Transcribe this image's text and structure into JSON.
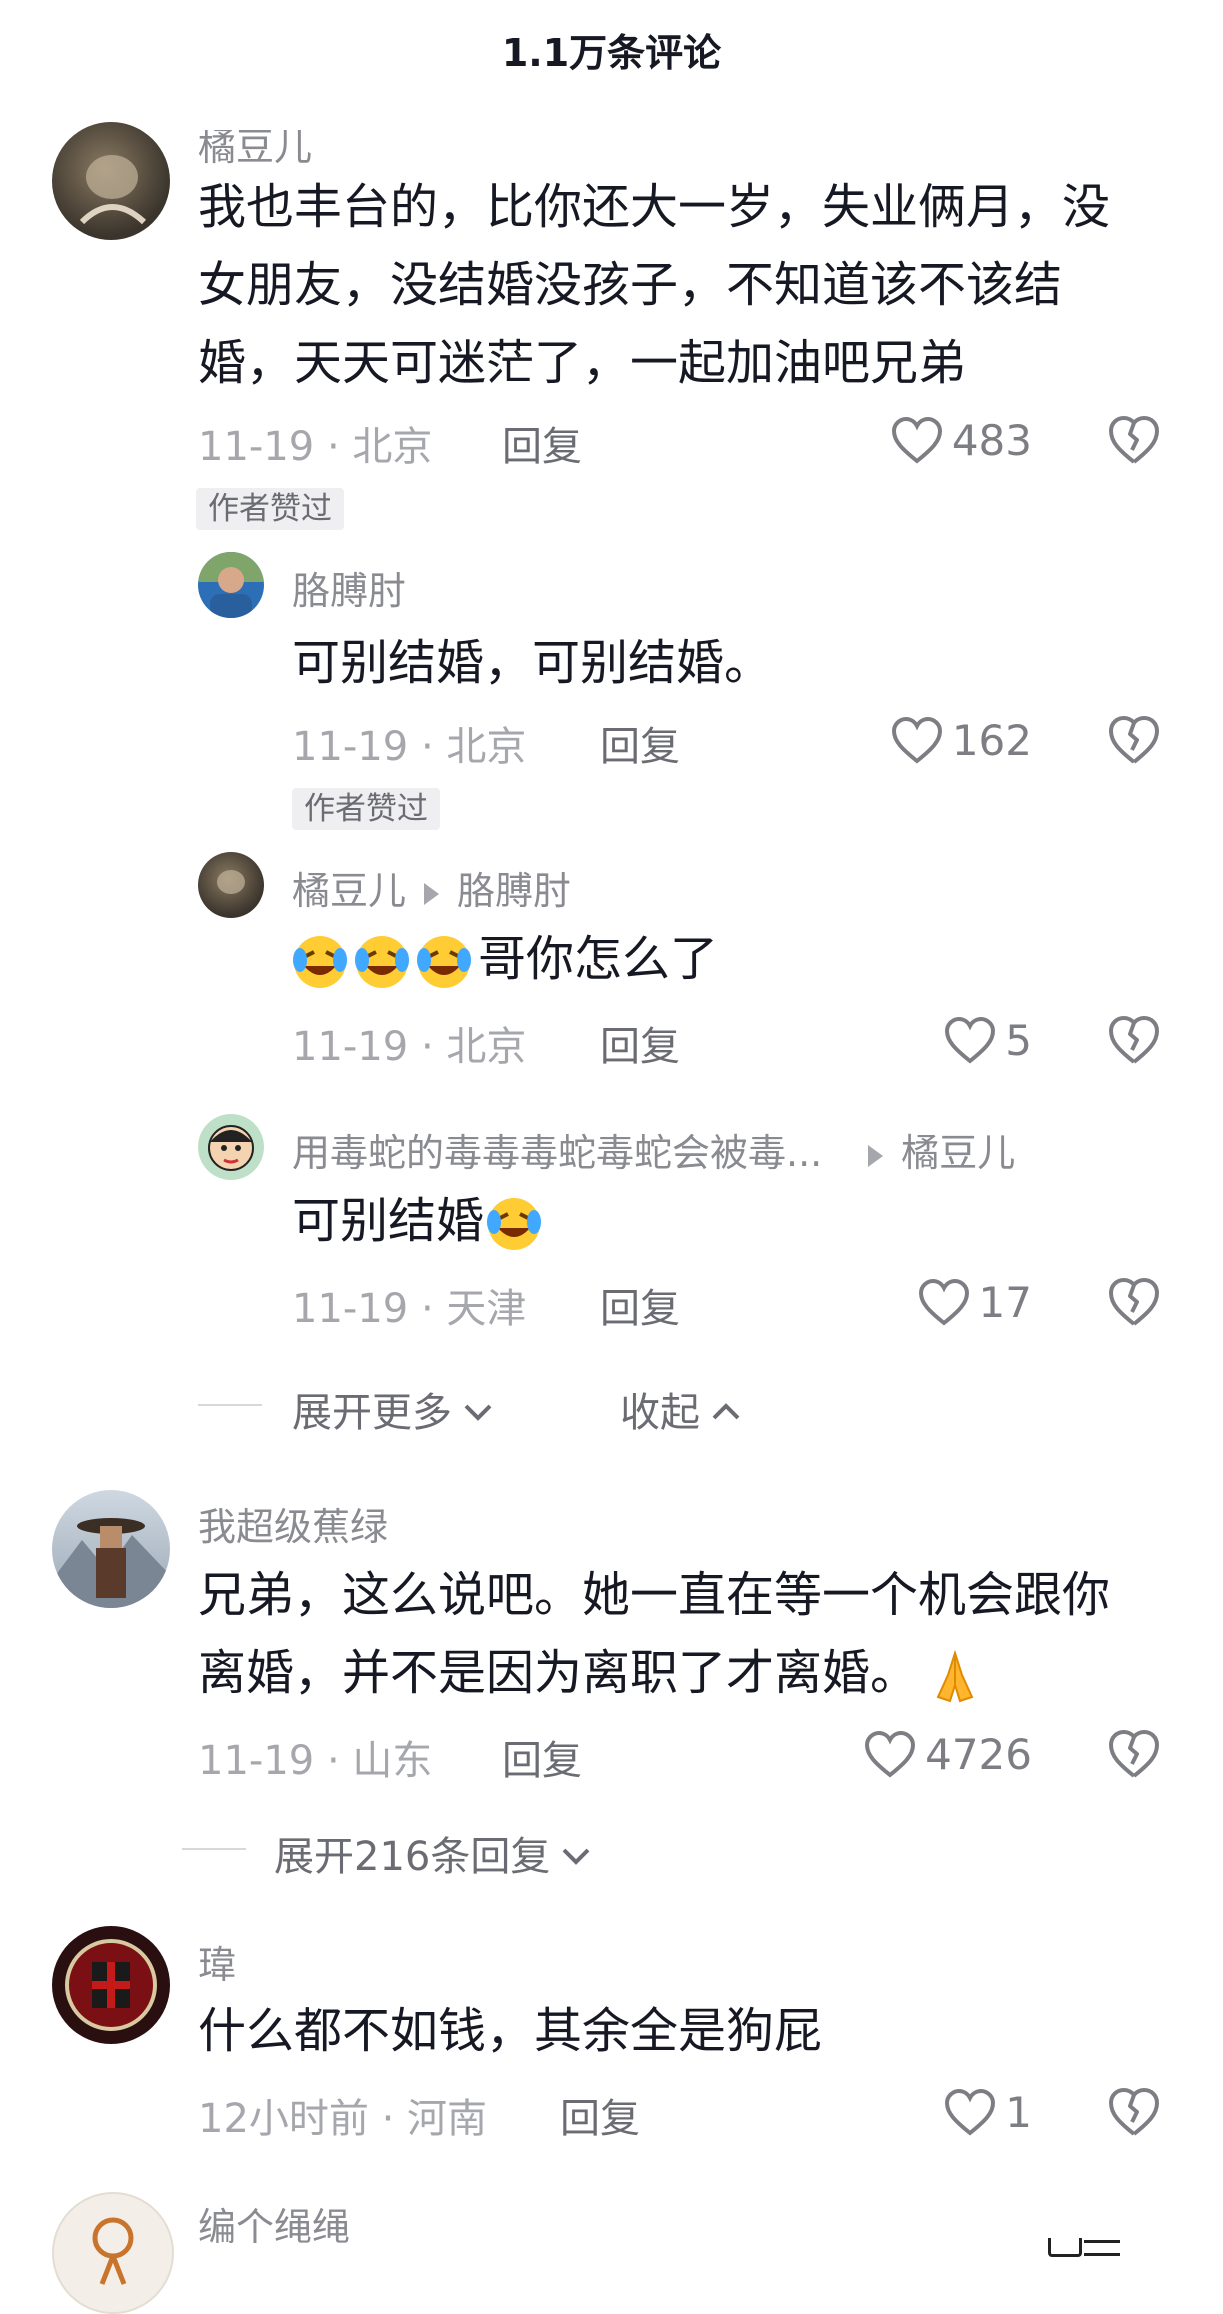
{
  "header": {
    "title": "1.1万条评论"
  },
  "comments": [
    {
      "username": "橘豆儿",
      "text_lines": [
        "我也丰台的，比你还大一岁，失业俩月，没",
        "女朋友，没结婚没孩子，不知道该不该结",
        "婚，天天可迷茫了，一起加油吧兄弟"
      ],
      "meta": "11-19 · 北京",
      "reply_label": "回复",
      "likes": "483",
      "badge": "作者赞过",
      "replies": [
        {
          "username": "胳膊肘",
          "text": "可别结婚，可别结婚。",
          "meta": "11-19 · 北京",
          "reply_label": "回复",
          "likes": "162",
          "badge": "作者赞过"
        },
        {
          "username": "橘豆儿",
          "reply_to": "胳膊肘",
          "text": "哥你怎么了",
          "emoji_count": 3,
          "meta": "11-19 · 北京",
          "reply_label": "回复",
          "likes": "5"
        },
        {
          "username": "用毒蛇的毒毒毒蛇毒蛇会被毒...",
          "reply_to": "橘豆儿",
          "text": "可别结婚",
          "emoji_count": 1,
          "meta": "11-19 · 天津",
          "reply_label": "回复",
          "likes": "17"
        }
      ],
      "expand_more": "展开更多",
      "collapse": "收起"
    },
    {
      "username": "我超级蕉绿",
      "text_lines": [
        "兄弟，这么说吧。她一直在等一个机会跟你",
        "离婚，并不是因为离职了才离婚。"
      ],
      "meta": "11-19 · 山东",
      "reply_label": "回复",
      "likes": "4726",
      "expand_replies": "展开216条回复"
    },
    {
      "username": "瑋",
      "text_lines": [
        "什么都不如钱，其余全是狗屁"
      ],
      "meta": "12小时前 · 河南",
      "reply_label": "回复",
      "likes": "1"
    },
    {
      "username": "编个绳绳"
    }
  ],
  "icons": {
    "like": "heart-outline-icon",
    "dislike": "broken-heart-icon",
    "chevron_down": "chevron-down-icon",
    "chevron_up": "chevron-up-icon"
  },
  "colors": {
    "text": "#161823",
    "secondary": "#8a8b91",
    "meta": "#a6a7ad"
  }
}
